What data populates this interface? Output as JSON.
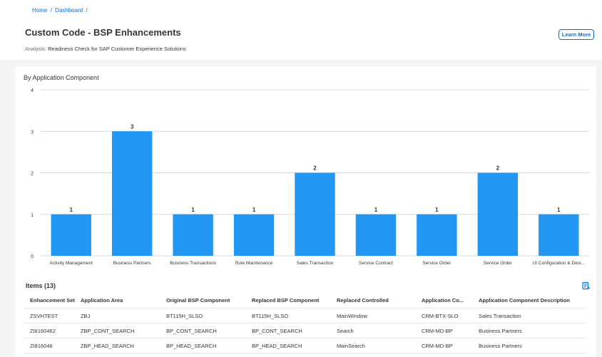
{
  "breadcrumb": {
    "home": "Home",
    "sep1": "/",
    "dashboard": "Dashboard",
    "sep2": "/"
  },
  "page": {
    "title": "Custom Code - BSP Enhancements",
    "analysis_label": "Analysis:",
    "analysis_value": "Readiness Check for SAP Customer Experience Solutions",
    "learn_more": "Learn More"
  },
  "chart_data": {
    "type": "bar",
    "title": "By Application Component",
    "categories": [
      "Activity Management",
      "Business Partners",
      "Business Transactions",
      "Rule Maintenance",
      "Sales Transaction",
      "Service Contract",
      "Service Order",
      "Service Order",
      "UI Configuration & Desi..."
    ],
    "values": [
      1,
      3,
      1,
      1,
      2,
      1,
      1,
      2,
      1
    ],
    "ylim": [
      0,
      4
    ],
    "yticks": [
      0,
      1,
      2,
      3,
      4
    ],
    "grid": true,
    "bar_color": "#2196f3"
  },
  "items": {
    "title": "Items (13)",
    "columns": [
      "Enhancement Set",
      "Application Area",
      "Original BSP Component",
      "Replaced BSP Component",
      "Replaced Controlled",
      "Application Co...",
      "Application Component Description"
    ],
    "rows": [
      [
        "ZSVHTEST",
        "ZBJ",
        "BT115H_SLSO",
        "BT115H_SLSO",
        "MainWindow",
        "CRM-BTX-SLO",
        "Sales Transaction"
      ],
      [
        "ZI8160462",
        "ZBP_CONT_SEARCH",
        "BP_CONT_SEARCH",
        "BP_CONT_SEARCH",
        "Search",
        "CRM-MD-BP",
        "Business Partners"
      ],
      [
        "ZI816046",
        "ZBP_HEAD_SEARCH",
        "BP_HEAD_SEARCH",
        "BP_HEAD_SEARCH",
        "MainSearch",
        "CRM-MD-BP",
        "Business Partners"
      ]
    ]
  }
}
